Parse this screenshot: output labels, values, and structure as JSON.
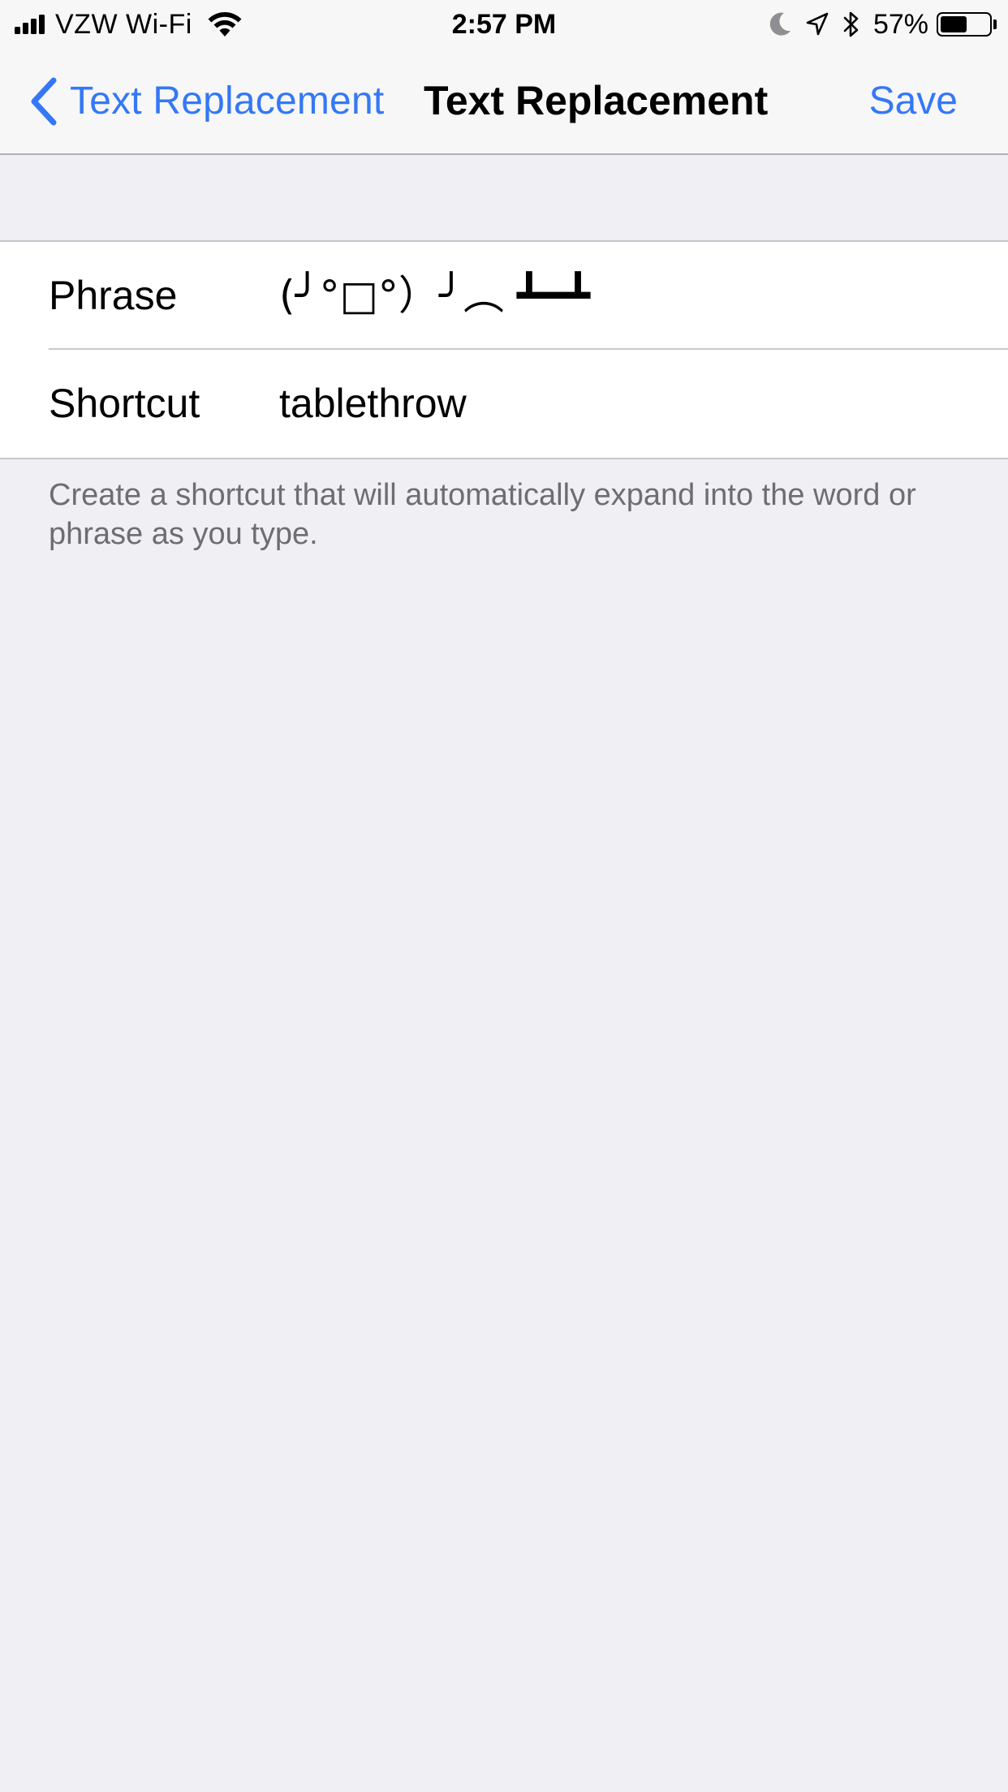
{
  "status_bar": {
    "carrier": "VZW Wi-Fi",
    "time": "2:57 PM",
    "battery_percent": "57%",
    "battery_level": 0.57,
    "icons": [
      "signal-icon",
      "wifi-icon",
      "moon-icon",
      "location-arrow-icon",
      "bluetooth-icon",
      "battery-icon"
    ]
  },
  "nav": {
    "back_label": "Text Replacement",
    "title": "Text Replacement",
    "save_label": "Save"
  },
  "form": {
    "phrase_label": "Phrase",
    "phrase_value": "(╯°□°）╯︵ ┻━┻",
    "shortcut_label": "Shortcut",
    "shortcut_value": "tablethrow"
  },
  "footer": {
    "text": "Create a shortcut that will automatically expand into the word or phrase as you type."
  },
  "colors": {
    "accent": "#3478f6",
    "background": "#efeff4",
    "bar_background": "#f7f7f7",
    "footer_text": "#6d6d72"
  }
}
